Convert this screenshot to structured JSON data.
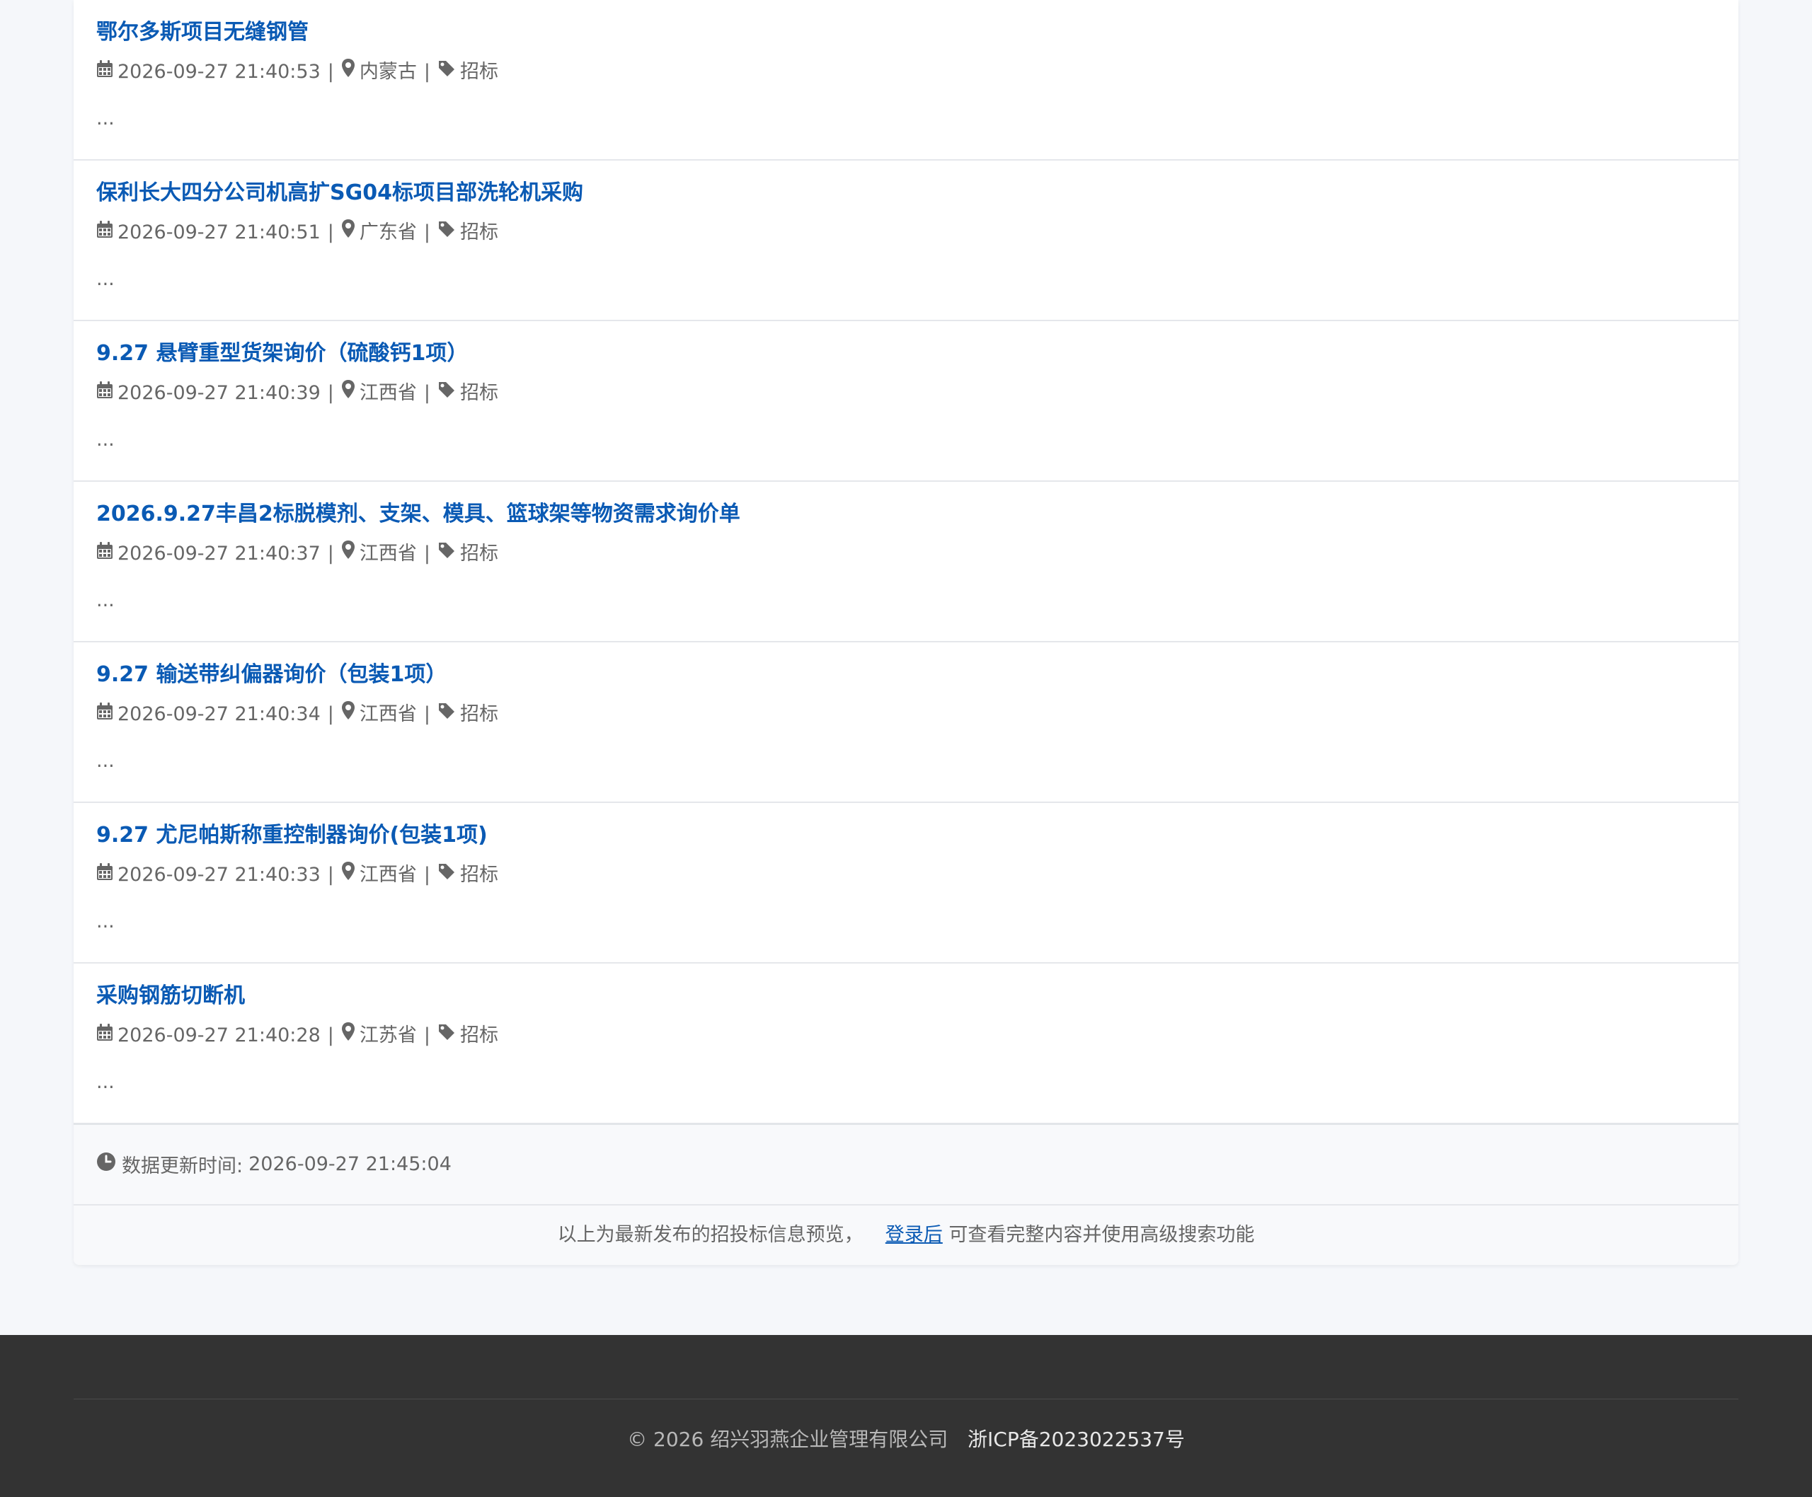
{
  "items": [
    {
      "title": "鄂尔多斯项目无缝钢管",
      "date": "2026-09-27 21:40:53",
      "region": "内蒙古",
      "type": "招标",
      "summary": "..."
    },
    {
      "title": "保利长大四分公司机高扩SG04标项目部洗轮机采购",
      "date": "2026-09-27 21:40:51",
      "region": "广东省",
      "type": "招标",
      "summary": "..."
    },
    {
      "title": "9.27 悬臂重型货架询价（硫酸钙1项）",
      "date": "2026-09-27 21:40:39",
      "region": "江西省",
      "type": "招标",
      "summary": "..."
    },
    {
      "title": "2026.9.27丰昌2标脱模剂、支架、模具、篮球架等物资需求询价单",
      "date": "2026-09-27 21:40:37",
      "region": "江西省",
      "type": "招标",
      "summary": "..."
    },
    {
      "title": "9.27 输送带纠偏器询价（包装1项）",
      "date": "2026-09-27 21:40:34",
      "region": "江西省",
      "type": "招标",
      "summary": "..."
    },
    {
      "title": "9.27 尤尼帕斯称重控制器询价(包装1项)",
      "date": "2026-09-27 21:40:33",
      "region": "江西省",
      "type": "招标",
      "summary": "..."
    },
    {
      "title": "采购钢筋切断机",
      "date": "2026-09-27 21:40:28",
      "region": "江苏省",
      "type": "招标",
      "summary": "..."
    }
  ],
  "meta": {
    "separator": "|"
  },
  "update": {
    "label": "数据更新时间:",
    "time": "2026-09-27 21:45:04"
  },
  "notice": {
    "prefix": "以上为最新发布的招投标信息预览，",
    "link": "登录后",
    "suffix": "可查看完整内容并使用高级搜索功能"
  },
  "footer": {
    "copyright": "© 2026 绍兴羽燕企业管理有限公司",
    "icp": "浙ICP备2023022537号"
  },
  "icons": {
    "date": "calendar-icon",
    "region": "map-marker-icon",
    "type": "tag-icon",
    "update": "clock-icon"
  },
  "colors": {
    "title": "#0a5ab4",
    "text": "#666666",
    "footer_bg": "#333333",
    "page_bg": "#f5f7fa"
  }
}
